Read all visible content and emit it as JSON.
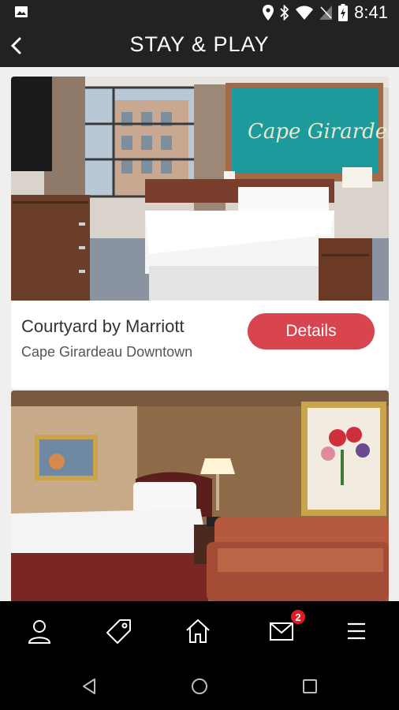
{
  "status_bar": {
    "time": "8:41",
    "icons": [
      "image-icon",
      "location-icon",
      "bluetooth-icon",
      "wifi-icon",
      "no-sim-icon",
      "battery-icon"
    ]
  },
  "header": {
    "title": "STAY & PLAY",
    "back_icon": "chevron-left-icon"
  },
  "cards": [
    {
      "name": "Courtyard by Marriott",
      "subtitle": "Cape Girardeau Downtown",
      "button_label": "Details",
      "wall_art_text": "Cape Girardeau"
    },
    {
      "name": "",
      "subtitle": "",
      "button_label": ""
    }
  ],
  "bottom_nav": {
    "items": [
      {
        "icon": "user-icon"
      },
      {
        "icon": "tag-icon"
      },
      {
        "icon": "home-icon"
      },
      {
        "icon": "mail-icon",
        "badge": "2"
      },
      {
        "icon": "menu-icon"
      }
    ]
  },
  "colors": {
    "header_bg": "#222222",
    "accent": "#d9454f",
    "badge": "#e01b24",
    "page_bg": "#efefef"
  }
}
